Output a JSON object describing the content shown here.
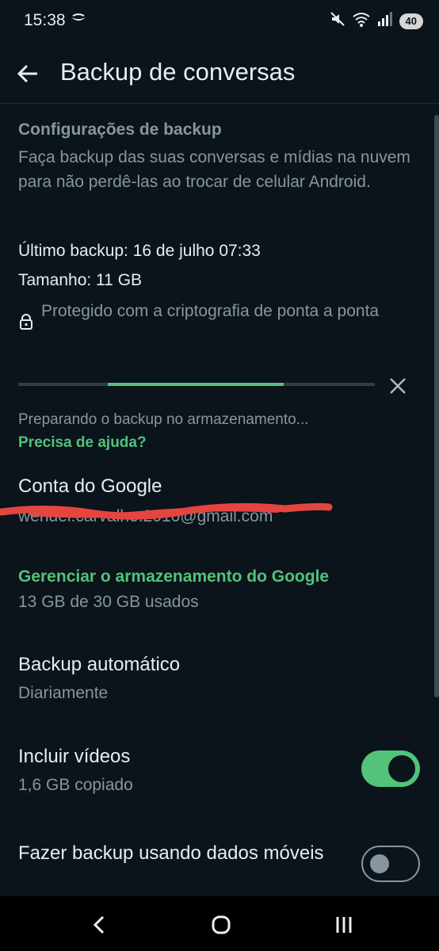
{
  "status_bar": {
    "time": "15:38",
    "battery": "40",
    "icons": [
      "notification-icon",
      "mute-icon",
      "wifi-icon",
      "signal-icon",
      "battery-icon"
    ]
  },
  "app_bar": {
    "title": "Backup de conversas",
    "back_icon": "arrow-left-icon"
  },
  "backup_settings": {
    "title": "Configurações de backup",
    "description": "Faça backup das suas conversas e mídias na nuvem para não perdê-las ao trocar de celular Android.",
    "last_backup": "Último backup: 16 de julho 07:33",
    "size": "Tamanho: 11 GB",
    "encryption": "Protegido com a criptografia de ponta a ponta"
  },
  "progress": {
    "status": "Preparando o backup no armazenamento...",
    "help_link": "Precisa de ajuda?"
  },
  "google_account": {
    "label": "Conta do Google",
    "email": "wendel.carvalho.2010@gmail.com"
  },
  "storage": {
    "manage_link": "Gerenciar o armazenamento do Google",
    "usage": "13 GB de 30 GB usados"
  },
  "auto_backup": {
    "label": "Backup automático",
    "value": "Diariamente"
  },
  "include_videos": {
    "label": "Incluir vídeos",
    "value": "1,6 GB copiado",
    "enabled": true
  },
  "mobile_data": {
    "label": "Fazer backup usando dados móveis",
    "enabled": false
  },
  "colors": {
    "background": "#0b141a",
    "accent": "#53c27a",
    "secondary_text": "#8696a0",
    "redaction": "#e5453f"
  }
}
